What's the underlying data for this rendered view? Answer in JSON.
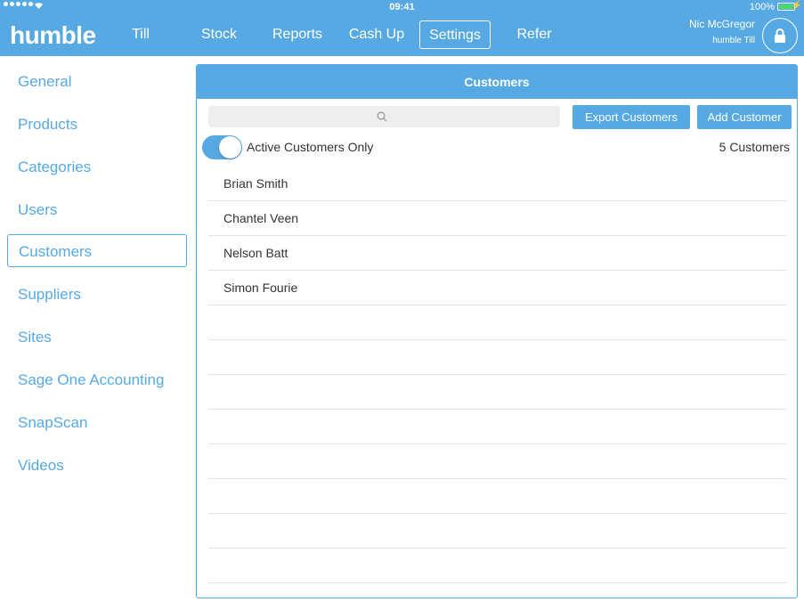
{
  "status": {
    "time": "09:41",
    "battery": "100%",
    "battery_level": 1.0
  },
  "header": {
    "logo": "humble",
    "nav": [
      {
        "label": "Till",
        "active": false
      },
      {
        "label": "Stock",
        "active": false
      },
      {
        "label": "Reports",
        "active": false
      },
      {
        "label": "Cash Up",
        "active": false
      },
      {
        "label": "Settings",
        "active": true
      },
      {
        "label": "Refer",
        "active": false
      }
    ],
    "user": {
      "name": "Nic McGregor",
      "subtitle": "humble Till"
    },
    "lock_icon": "lock-icon"
  },
  "sidebar": {
    "items": [
      {
        "label": "General",
        "active": false
      },
      {
        "label": "Products",
        "active": false
      },
      {
        "label": "Categories",
        "active": false
      },
      {
        "label": "Users",
        "active": false
      },
      {
        "label": "Customers",
        "active": true
      },
      {
        "label": "Suppliers",
        "active": false
      },
      {
        "label": "Sites",
        "active": false
      },
      {
        "label": "Sage One Accounting",
        "active": false
      },
      {
        "label": "SnapScan",
        "active": false
      },
      {
        "label": "Videos",
        "active": false
      }
    ]
  },
  "panel": {
    "title": "Customers",
    "search": {
      "value": "",
      "placeholder": "",
      "icon": "search-icon"
    },
    "export_button": "Export Customers",
    "add_button": "Add Customer",
    "toggle": {
      "label": "Active Customers Only",
      "on": true
    },
    "count_label": "5 Customers",
    "customers": [
      "Brian Smith",
      "Chantel Veen",
      "Nelson Batt",
      "Simon Fourie"
    ]
  },
  "colors": {
    "accent": "#56a9e2",
    "battery": "#4cd964",
    "text": "#333333",
    "divider": "#e3e3e3"
  }
}
